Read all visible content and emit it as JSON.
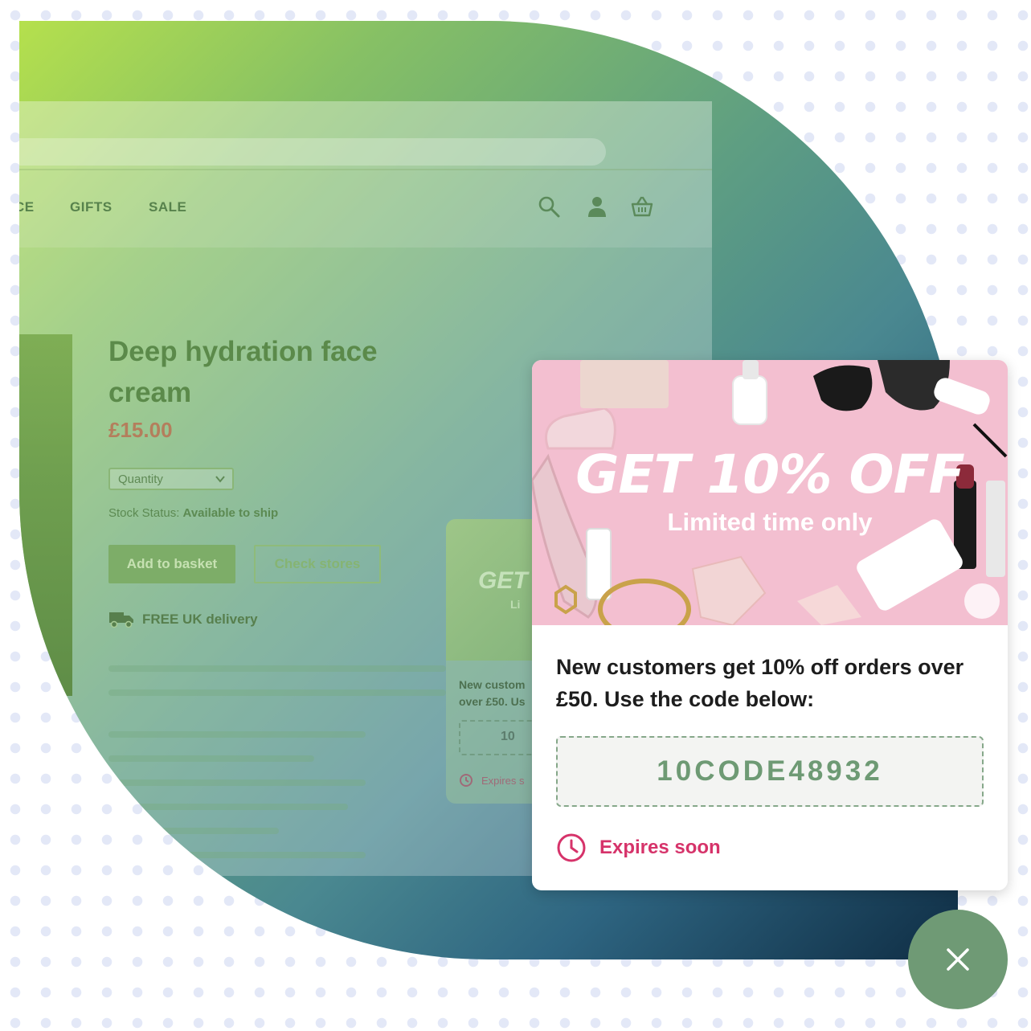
{
  "nav": {
    "items": [
      "CE",
      "GIFTS",
      "SALE"
    ],
    "icons": [
      "search-icon",
      "account-icon",
      "basket-icon"
    ]
  },
  "product": {
    "title": "Deep hydration face cream",
    "price": "£15.00",
    "quantity_label": "Quantity",
    "stock_label": "Stock Status:",
    "stock_value": "Available to ship",
    "add_button": "Add to basket",
    "stores_button": "Check stores",
    "delivery": "FREE UK delivery"
  },
  "mini_popup": {
    "headline": "GET",
    "subline": "Li",
    "text_line1": "New custom",
    "text_line2": "over £50. Us",
    "code": "10",
    "expires": "Expires s"
  },
  "popup": {
    "headline": "GET 10% OFF",
    "subline": "Limited time only",
    "message": "New customers get 10% off orders over £50. Use the code below:",
    "code": "10CODE48932",
    "expires": "Expires soon"
  },
  "colors": {
    "accent_pink": "#d6336a",
    "close_green": "#6f9a75",
    "code_green": "#6e9a74"
  }
}
